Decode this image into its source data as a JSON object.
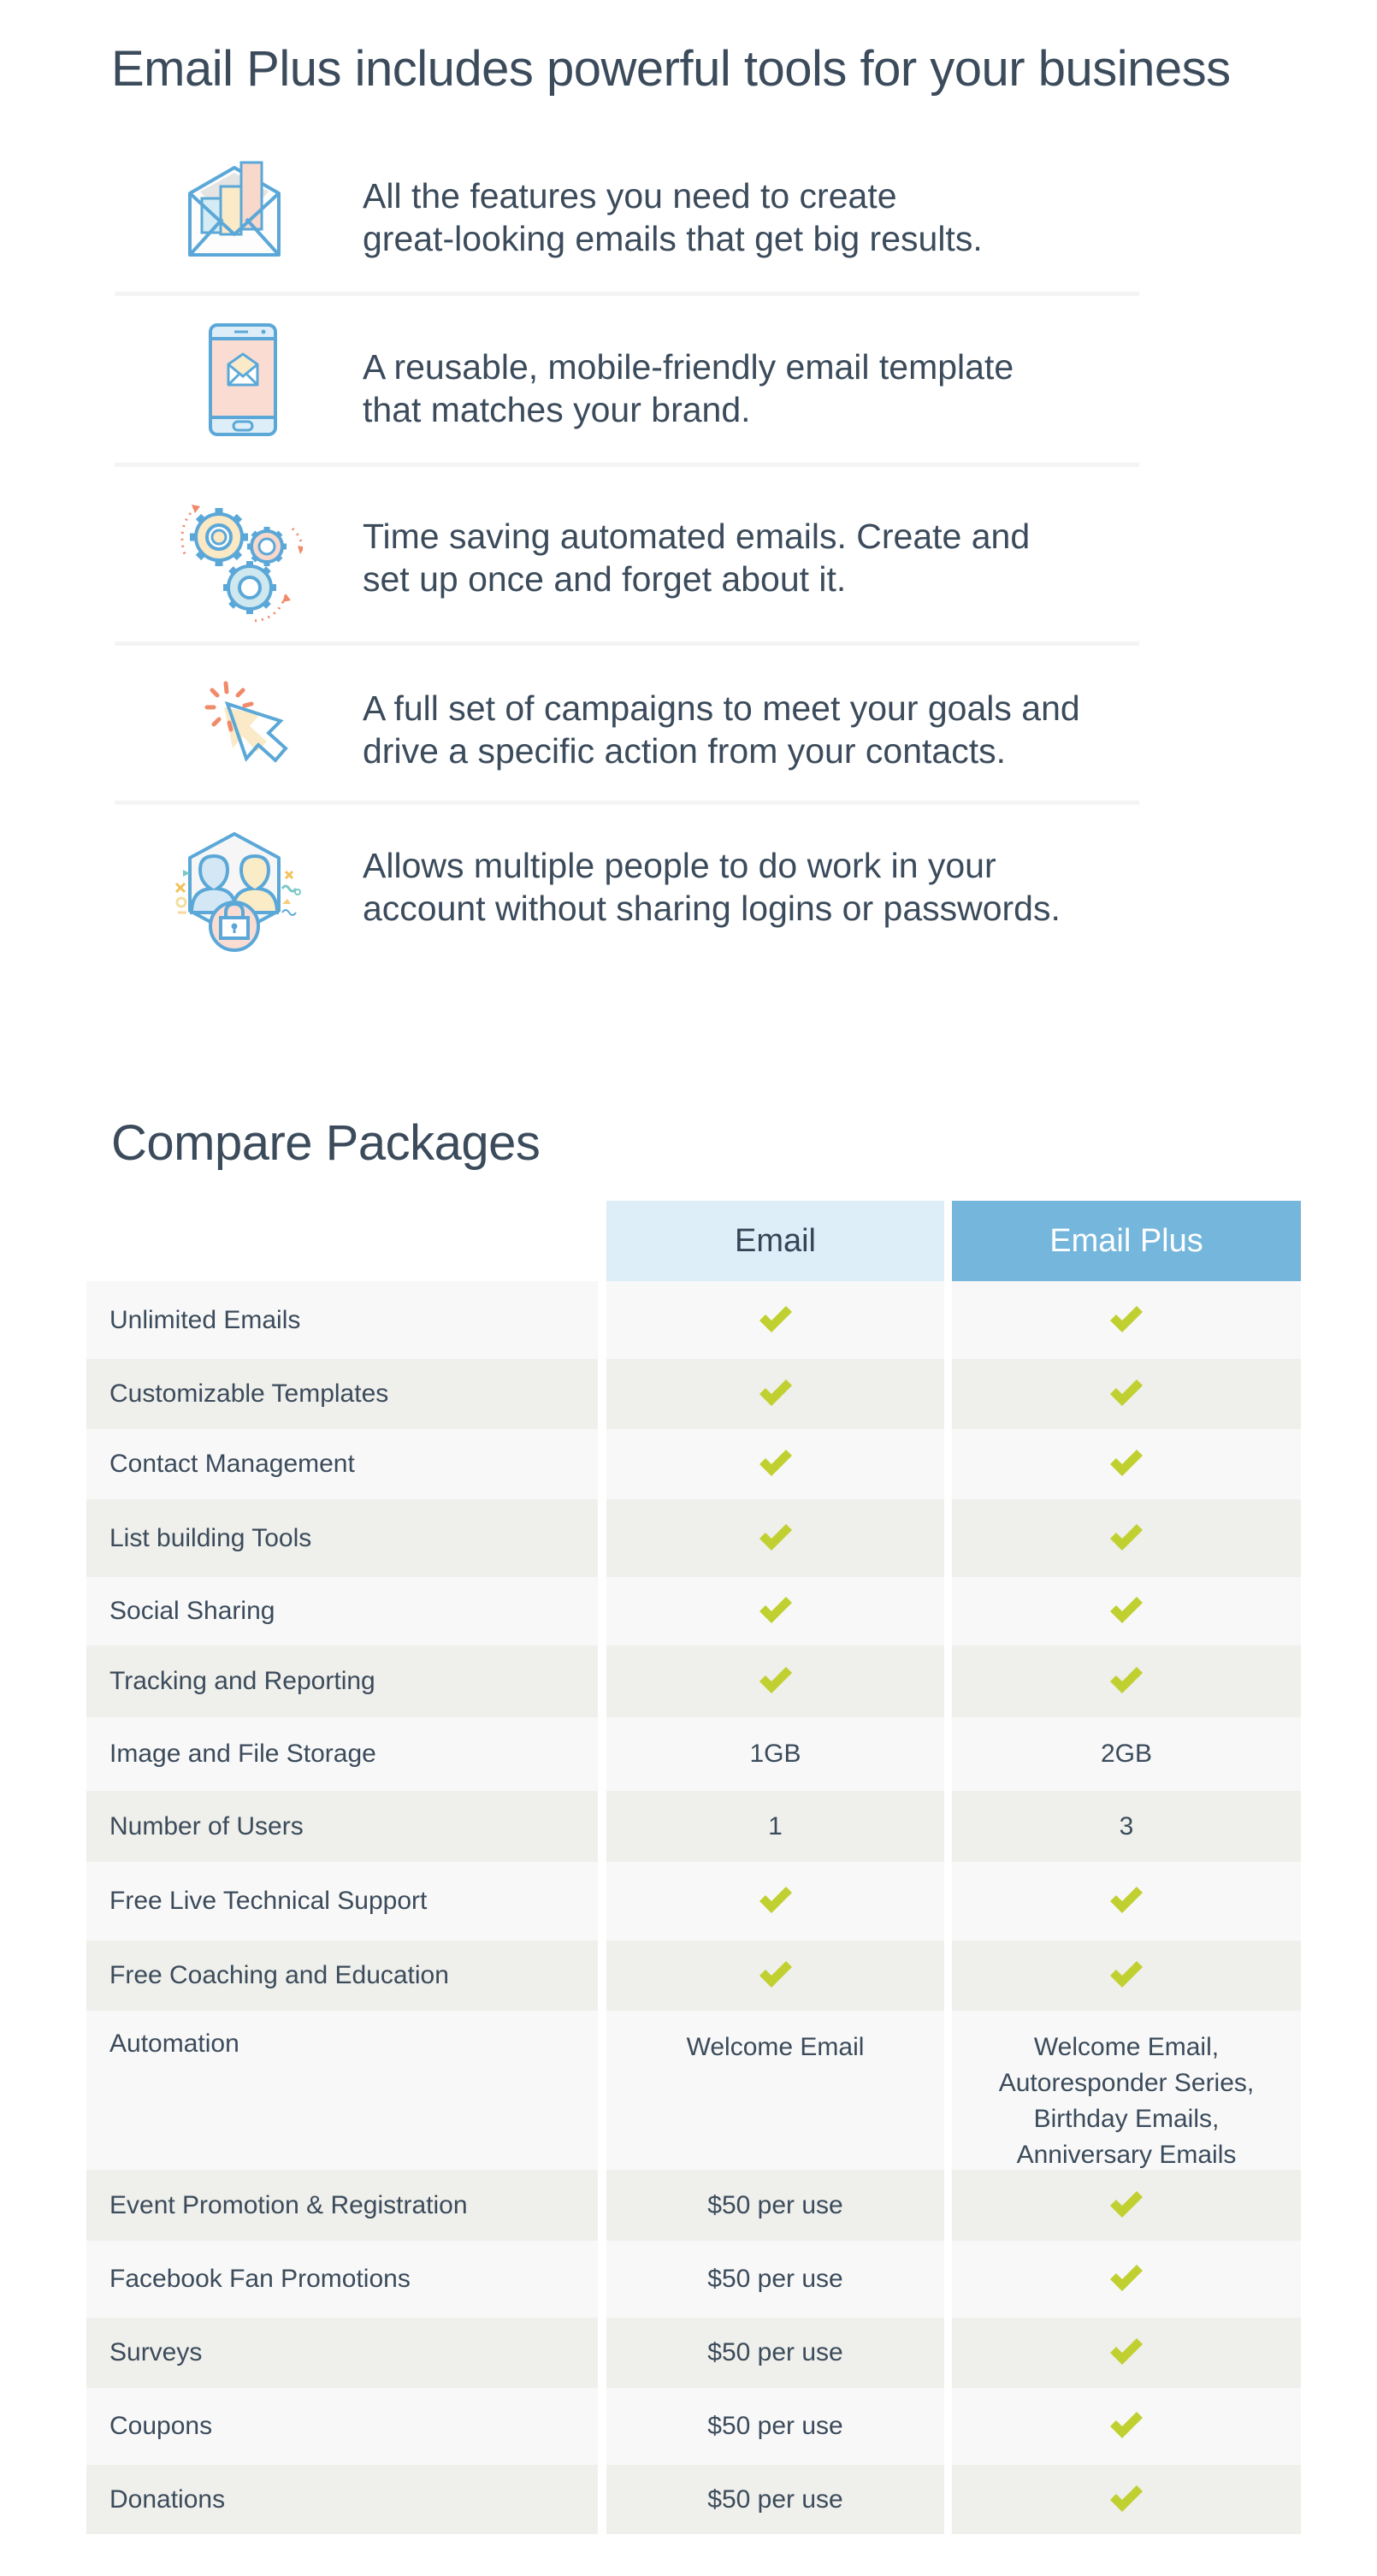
{
  "features_section": {
    "title": "Email Plus includes powerful tools for your business",
    "items": [
      {
        "icon": "email-chart-icon",
        "line1": "All the features you need to create",
        "line2": "great-looking emails that get big results."
      },
      {
        "icon": "mobile-email-icon",
        "line1": "A reusable, mobile-friendly email template",
        "line2": "that matches your brand."
      },
      {
        "icon": "gears-icon",
        "line1": "Time saving automated emails. Create and",
        "line2": "set up once and forget about it."
      },
      {
        "icon": "cursor-click-icon",
        "line1": "A full set of campaigns to meet your goals and",
        "line2": "drive a specific action from your contacts."
      },
      {
        "icon": "users-lock-icon",
        "line1": "Allows multiple people to do work in your",
        "line2": "account without sharing logins or passwords."
      }
    ]
  },
  "compare_section": {
    "title": "Compare Packages",
    "columns": [
      "Email",
      "Email Plus"
    ],
    "colors": {
      "email_header_bg": "#deeef8",
      "plus_header_bg": "#74b6dc",
      "check": "#c0d030"
    },
    "rows": [
      {
        "feature": "Unlimited Emails",
        "email": "check",
        "plus": "check"
      },
      {
        "feature": "Customizable Templates",
        "email": "check",
        "plus": "check"
      },
      {
        "feature": "Contact Management",
        "email": "check",
        "plus": "check"
      },
      {
        "feature": "List building Tools",
        "email": "check",
        "plus": "check"
      },
      {
        "feature": "Social Sharing",
        "email": "check",
        "plus": "check"
      },
      {
        "feature": "Tracking and Reporting",
        "email": "check",
        "plus": "check"
      },
      {
        "feature": "Image and File Storage",
        "email": "1GB",
        "plus": "2GB"
      },
      {
        "feature": "Number of Users",
        "email": "1",
        "plus": "3"
      },
      {
        "feature": "Free  Live Technical Support",
        "email": "check",
        "plus": "check"
      },
      {
        "feature": "Free Coaching and Education",
        "email": "check",
        "plus": "check"
      },
      {
        "feature": "Automation",
        "email": "Welcome Email",
        "plus": [
          "Welcome Email,",
          "Autoresponder Series,",
          "Birthday Emails,",
          "Anniversary Emails"
        ]
      },
      {
        "feature": "Event Promotion & Registration",
        "email": "$50 per use",
        "plus": "check"
      },
      {
        "feature": "Facebook Fan Promotions",
        "email": "$50 per use",
        "plus": "check"
      },
      {
        "feature": "Surveys",
        "email": "$50 per use",
        "plus": "check"
      },
      {
        "feature": "Coupons",
        "email": "$50 per use",
        "plus": "check"
      },
      {
        "feature": "Donations",
        "email": "$50 per use",
        "plus": "check"
      }
    ]
  }
}
